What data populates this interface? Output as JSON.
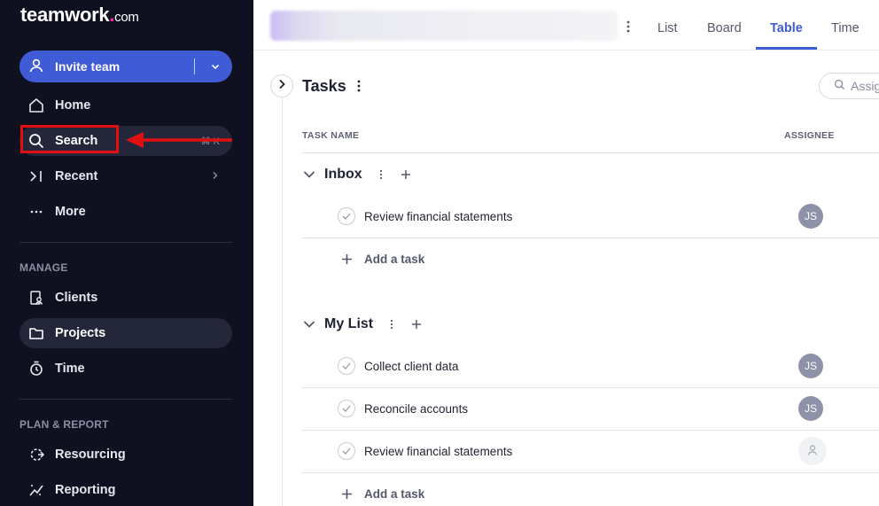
{
  "sidebar": {
    "logo": {
      "word": "teamwork",
      "dot": ".",
      "suffix": "com"
    },
    "invite_label": "Invite team",
    "nav": [
      {
        "label": "Home",
        "icon": "home-icon"
      },
      {
        "label": "Search",
        "icon": "search-icon",
        "shortcut": "⌘ K"
      },
      {
        "label": "Recent",
        "icon": "recent-icon"
      },
      {
        "label": "More",
        "icon": "more-dots-icon"
      }
    ],
    "manage_title": "MANAGE",
    "manage": [
      {
        "label": "Clients",
        "icon": "clients-icon"
      },
      {
        "label": "Projects",
        "icon": "folder-icon"
      },
      {
        "label": "Time",
        "icon": "timer-icon"
      }
    ],
    "plan_title": "PLAN & REPORT",
    "plan": [
      {
        "label": "Resourcing",
        "icon": "resourcing-icon"
      },
      {
        "label": "Reporting",
        "icon": "reporting-icon"
      }
    ]
  },
  "topbar": {
    "tabs": [
      {
        "label": "List"
      },
      {
        "label": "Board"
      },
      {
        "label": "Table",
        "active": true
      },
      {
        "label": "Time"
      }
    ]
  },
  "main": {
    "title": "Tasks",
    "search_placeholder": "Assig",
    "columns": {
      "task_name": "TASK NAME",
      "assignee": "ASSIGNEE"
    },
    "groups": [
      {
        "name": "Inbox",
        "tasks": [
          {
            "name": "Review financial statements",
            "assignee": "JS"
          }
        ],
        "add_label": "Add a task"
      },
      {
        "name": "My List",
        "tasks": [
          {
            "name": "Collect client data",
            "assignee": "JS"
          },
          {
            "name": "Reconcile accounts",
            "assignee": "JS"
          },
          {
            "name": "Review financial statements",
            "assignee": ""
          }
        ],
        "add_label": "Add a task"
      }
    ]
  },
  "colors": {
    "accent": "#3f5bd6",
    "sidebar_bg": "#0f1120",
    "annotation": "#e01010"
  }
}
